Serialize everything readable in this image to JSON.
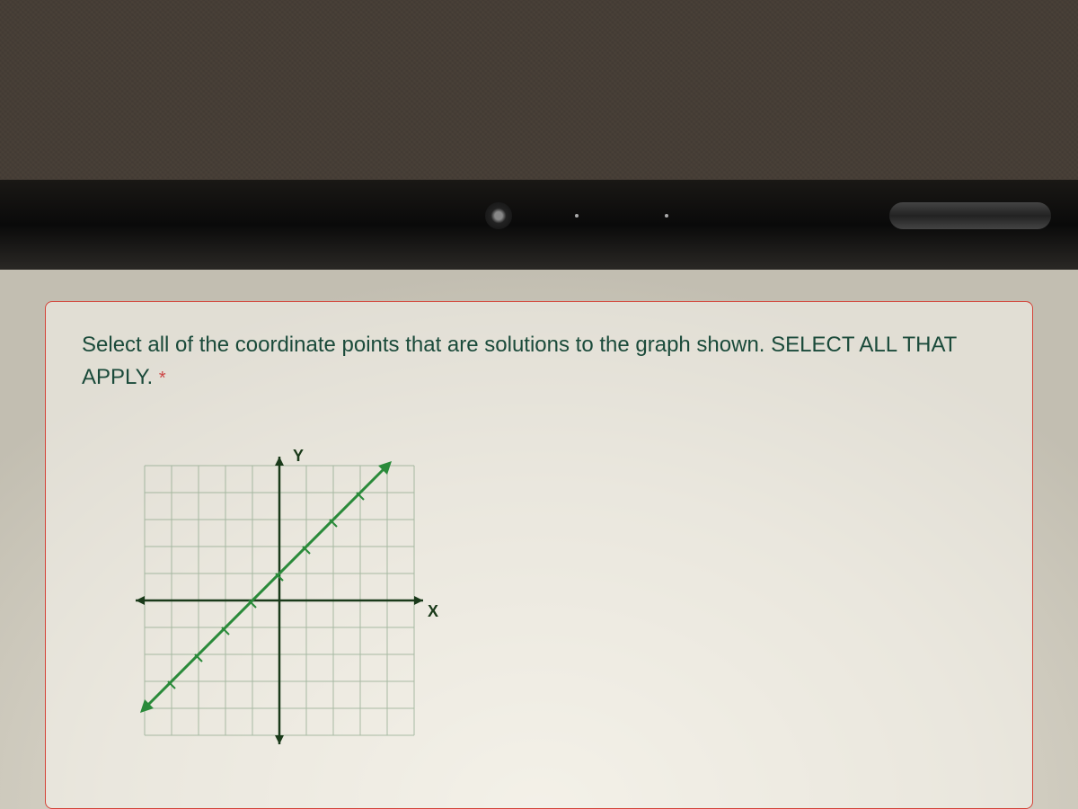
{
  "question": {
    "text": "Select all of the coordinate points that are solutions to the graph shown. SELECT ALL THAT APPLY.",
    "required_marker": "*"
  },
  "graph": {
    "x_axis_label": "X",
    "y_axis_label": "Y"
  },
  "chart_data": {
    "type": "line",
    "title": "",
    "xlabel": "X",
    "ylabel": "Y",
    "x_range": [
      -5,
      5
    ],
    "y_range": [
      -5,
      5
    ],
    "grid": true,
    "series": [
      {
        "name": "line",
        "description": "y = x + 1",
        "x": [
          -5,
          -4,
          -3,
          -2,
          -1,
          0,
          1,
          2,
          3,
          4
        ],
        "y": [
          -4,
          -3,
          -2,
          -1,
          0,
          1,
          2,
          3,
          4,
          5
        ],
        "color": "#2a8a3a"
      }
    ]
  }
}
